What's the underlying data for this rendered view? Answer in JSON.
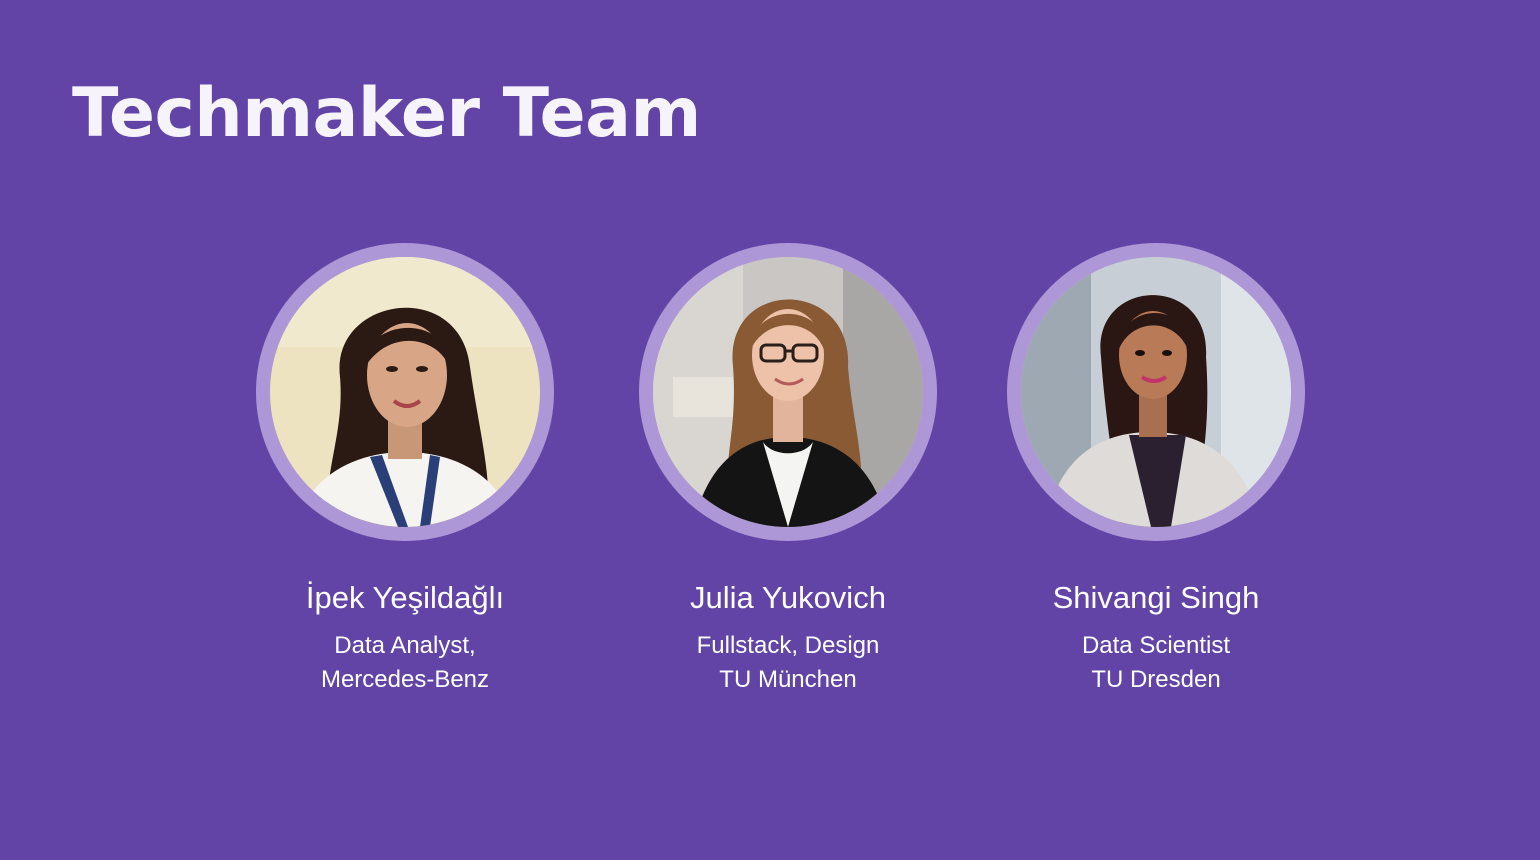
{
  "slide": {
    "title": "Techmaker Team",
    "background_color": "#6244a6",
    "ring_color": "#ad97d6"
  },
  "members": [
    {
      "name": "İpek Yeşildağlı",
      "role_line1": "Data Analyst,",
      "role_line2": "Mercedes-Benz",
      "photo_icon": "portrait-photo"
    },
    {
      "name": "Julia Yukovich",
      "role_line1": "Fullstack, Design",
      "role_line2": "TU München",
      "photo_icon": "portrait-photo"
    },
    {
      "name": "Shivangi Singh",
      "role_line1": "Data Scientist",
      "role_line2": "TU Dresden",
      "photo_icon": "portrait-photo"
    }
  ]
}
